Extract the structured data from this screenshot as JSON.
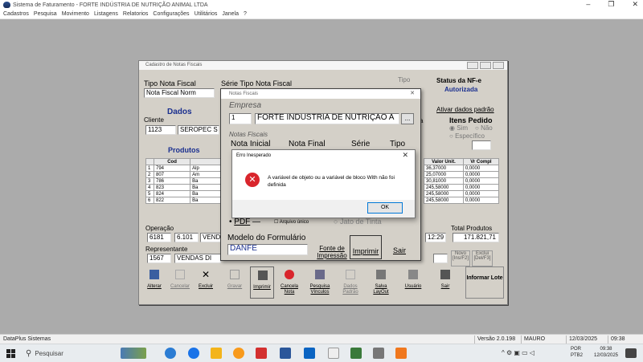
{
  "app": {
    "title": "Sistema de Faturamento - FORTE INDÚSTRIA DE NUTRIÇÃO ANIMAL LTDA",
    "menu": [
      "Cadastros",
      "Pesquisa",
      "Movimento",
      "Listagens",
      "Relatorios",
      "Configurações",
      "Utilitários",
      "Janela",
      "?"
    ],
    "window_buttons": [
      "–",
      "❐",
      "✕"
    ]
  },
  "form": {
    "title": "Cadastro de Notas Fiscais",
    "tipo_nf_label": "Tipo Nota Fiscal",
    "tipo_nf_value": "Nota Fiscal Norm",
    "serie_label": "Série Tipo Nota Fiscal",
    "tipo_label": "Tipo",
    "status_label": "Status da NF-e",
    "status_value": "Autorizada",
    "dados_tab": "Dados",
    "cliente_label": "Cliente",
    "cliente_code": "1123",
    "cliente_name": "SEROPEC S",
    "produtos_label": "Produtos",
    "ativar_dados": "Ativar dados padrão",
    "itens_pedido": "Itens Pedido",
    "sim_label": "Sim",
    "nao_label": "Não",
    "especifico_label": "Específico",
    "entrega_label": "ega",
    "grid_headers": [
      "Cod",
      "Valor Unit.",
      "Vr Compl"
    ],
    "grid_rows": [
      {
        "n": "1",
        "cod": "794",
        "desc": "Alp",
        "valor": "36,37000",
        "compl": "0,0000"
      },
      {
        "n": "2",
        "cod": "807",
        "desc": "Am",
        "valor": "25,07000",
        "compl": "0,0000"
      },
      {
        "n": "3",
        "cod": "786",
        "desc": "Ba",
        "valor": "30,81000",
        "compl": "0,0000"
      },
      {
        "n": "4",
        "cod": "823",
        "desc": "Ba",
        "valor": "245,58000",
        "compl": "0,0000"
      },
      {
        "n": "5",
        "cod": "824",
        "desc": "Ba",
        "valor": "245,58000",
        "compl": "0,0000"
      },
      {
        "n": "6",
        "cod": "822",
        "desc": "Ba",
        "valor": "245,58000",
        "compl": "0,0000"
      }
    ],
    "operacao_label": "Operação",
    "operacao_code": "6181",
    "operacao_value": "6.101",
    "operacao_text": "VEND",
    "representante_label": "Representante",
    "representante_code": "1567",
    "representante_name": "VENDAS DI",
    "hora_value": "12:29",
    "total_label": "Total Produtos",
    "total_value": "171.821,71",
    "novo_label": "Novo",
    "novo_key": "[Ins/F2]",
    "exclui_label": "Exclui",
    "exclui_key": "[Del/F3]",
    "toolbar": [
      {
        "name": "alterar",
        "label": "Alterar"
      },
      {
        "name": "cancelar",
        "label": "Cancelar"
      },
      {
        "name": "excluir",
        "label": "Excluir"
      },
      {
        "name": "gravar",
        "label": "Gravar"
      },
      {
        "name": "imprimir",
        "label": "Imprimir"
      },
      {
        "name": "cancela-nota",
        "label": "Cancela Nota"
      },
      {
        "name": "pesquisa-vinculos",
        "label": "Pesquisa Vínculos"
      },
      {
        "name": "dados-padrao",
        "label": "Dados Padrão"
      },
      {
        "name": "salva-layout",
        "label": "Salva LayOut"
      },
      {
        "name": "usuario",
        "label": "Usuário"
      },
      {
        "name": "sair",
        "label": "Sair"
      },
      {
        "name": "informar-lote",
        "label": "Informar Lote"
      }
    ]
  },
  "nf_dialog": {
    "title": "Notas Fiscais",
    "empresa_label": "Empresa",
    "empresa_code": "1",
    "empresa_name": "FORTE INDÚSTRIA DE NUTRIÇÃO A",
    "browse_label": "...",
    "notas_label": "Notas Fiscais",
    "col_inicial": "Nota Inicial",
    "col_final": "Nota Final",
    "col_serie": "Série",
    "col_tipo": "Tipo",
    "pdf_label": "PDF",
    "arquivo_unico": "Arquivo único",
    "jato_tinta": "Jato de Tinta",
    "modelo_label": "Modelo do Formulário",
    "modelo_value": "DANFE",
    "fonte_label": "Fonte de Impressão",
    "imprimir_label": "Imprimir",
    "sair_label": "Sair"
  },
  "error_dialog": {
    "title": "Erro Inesperado",
    "message": "A variável de objeto ou a variável de bloco With não foi definida",
    "ok_label": "OK"
  },
  "statusbar": {
    "company": "DataPlus Sistemas",
    "version": "Versão 2.0.198",
    "user": "MAURO",
    "date": "12/03/2025",
    "time": "09:38"
  },
  "taskbar": {
    "search_placeholder": "Pesquisar",
    "lang": "POR",
    "layout": "PTB2",
    "time": "09:38",
    "date": "12/03/2025"
  },
  "colors": {
    "error_red": "#d9252c",
    "status_blue": "#1a2f8f",
    "workspace": "#ababab"
  }
}
